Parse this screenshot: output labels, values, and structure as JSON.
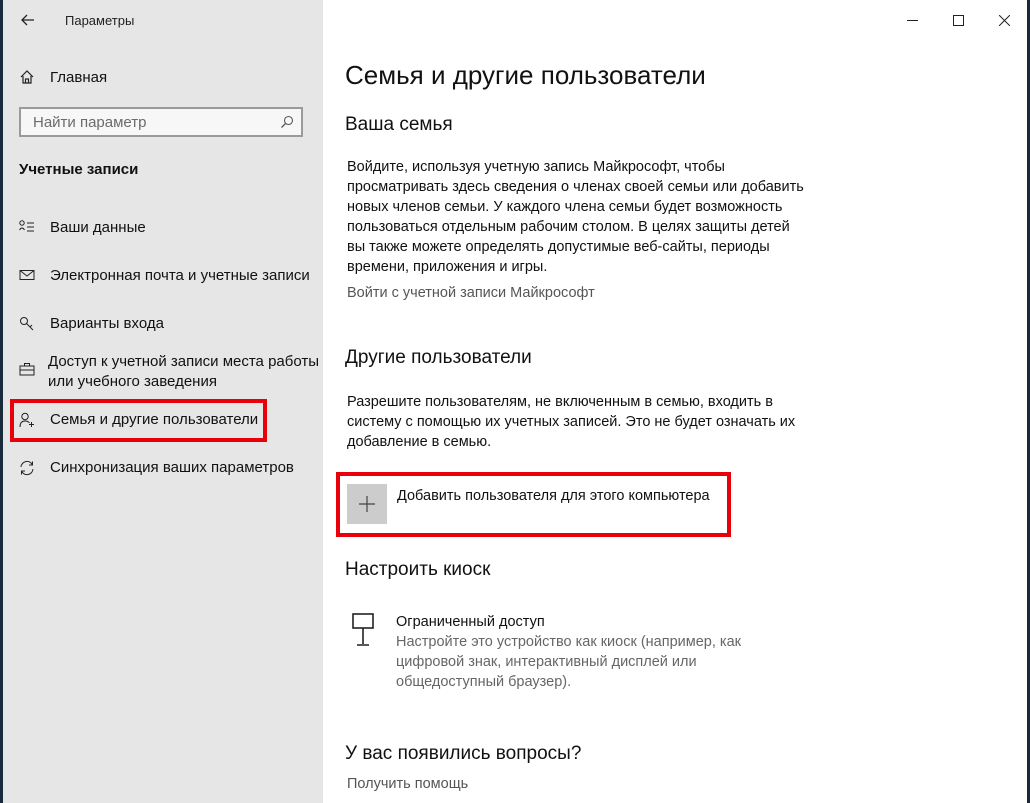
{
  "window": {
    "app_title": "Параметры"
  },
  "sidebar": {
    "home_label": "Главная",
    "search_placeholder": "Найти параметр",
    "section_title": "Учетные записи",
    "items": [
      {
        "label": "Ваши данные",
        "icon": "user-info-icon"
      },
      {
        "label": "Электронная почта и учетные записи",
        "icon": "mail-icon"
      },
      {
        "label": "Варианты входа",
        "icon": "key-icon"
      },
      {
        "label": "Доступ к учетной записи места работы или учебного заведения",
        "icon": "briefcase-icon"
      },
      {
        "label": "Семья и другие пользователи",
        "icon": "person-add-icon"
      },
      {
        "label": "Синхронизация ваших параметров",
        "icon": "sync-icon"
      }
    ],
    "selected_index": 4
  },
  "main": {
    "title": "Семья и другие пользователи",
    "family": {
      "heading": "Ваша семья",
      "text": "Войдите, используя учетную запись Майкрософт, чтобы просматривать здесь сведения о членах своей семьи или добавить новых членов семьи. У каждого члена семьи будет возможность пользоваться отдельным рабочим столом. В целях защиты детей вы также можете определять допустимые веб-сайты, периоды времени, приложения и игры.",
      "link": "Войти с учетной записи Майкрософт"
    },
    "others": {
      "heading": "Другие пользователи",
      "text": "Разрешите пользователям, не включенным в семью, входить в систему с помощью их учетных записей. Это не будет означать их добавление в семью.",
      "add_label": "Добавить пользователя для этого компьютера"
    },
    "kiosk": {
      "heading": "Настроить киоск",
      "item_title": "Ограниченный доступ",
      "item_desc": "Настройте это устройство как киоск (например, как цифровой знак, интерактивный дисплей или общедоступный браузер)."
    },
    "questions": {
      "heading": "У вас появились вопросы?",
      "link": "Получить помощь"
    }
  },
  "colors": {
    "highlight": "#e8000b",
    "sidebar_bg": "#e6e6e6"
  }
}
